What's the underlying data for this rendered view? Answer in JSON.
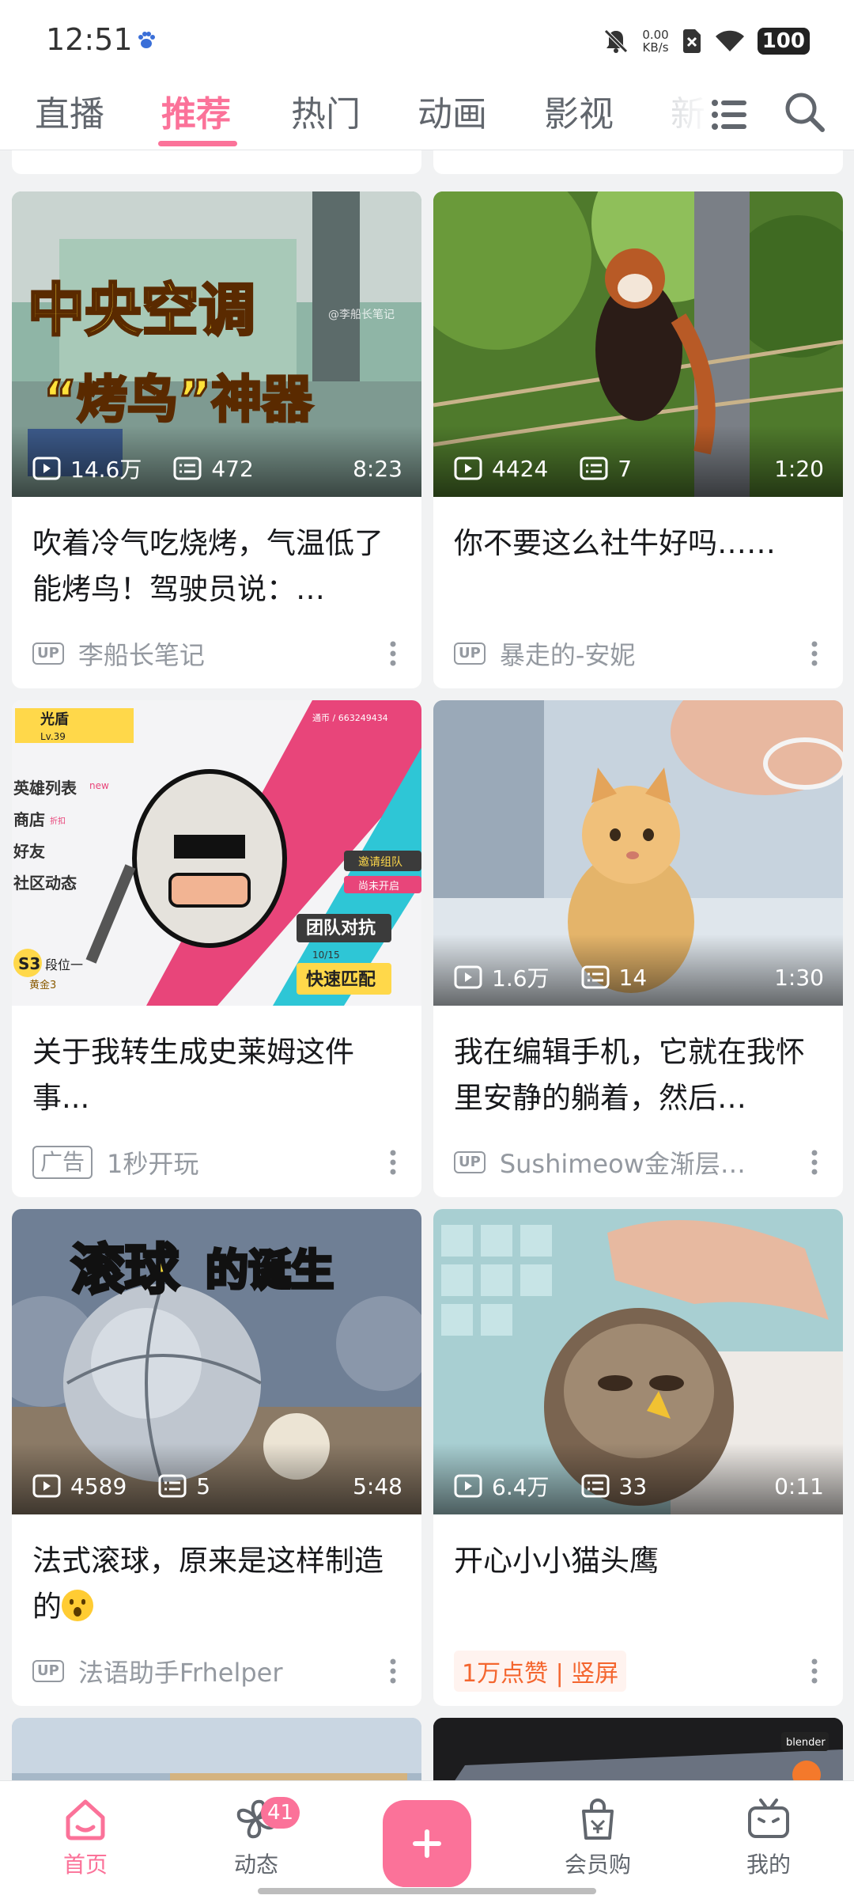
{
  "status_bar": {
    "time": "12:51",
    "net_speed_value": "0.00",
    "net_speed_unit": "KB/s",
    "battery": "100",
    "icons": [
      "baidu-paw-icon",
      "mute-icon",
      "sim-x-icon",
      "wifi-icon",
      "battery-icon"
    ]
  },
  "tabs": {
    "items": [
      {
        "label": "直播",
        "active": false
      },
      {
        "label": "推荐",
        "active": true
      },
      {
        "label": "热门",
        "active": false
      },
      {
        "label": "动画",
        "active": false
      },
      {
        "label": "影视",
        "active": false
      },
      {
        "label": "新",
        "active": false
      }
    ],
    "accent_color": "#fb7299"
  },
  "feed": {
    "cards": [
      {
        "plays": "14.6万",
        "danmaku": "472",
        "duration": "8:23",
        "cover_text_line1": "中央空调",
        "cover_text_line2": "“烤鸟”神器",
        "cover_watermark": "@李船长笔记",
        "title": "吹着冷气吃烧烤，气温低了能烤鸟！驾驶员说：…",
        "tag": "UP",
        "uploader": "李船长笔记"
      },
      {
        "plays": "4424",
        "danmaku": "7",
        "duration": "1:20",
        "title": "你不要这么社牛好吗……",
        "tag": "UP",
        "uploader": "暴走的-安妮"
      },
      {
        "cover_lines": {
          "name": "光盾",
          "level": "Lv.39",
          "id": "通币 / 663249434",
          "menu": [
            "英雄列表",
            "商店",
            "好友",
            "社区动态"
          ],
          "new_badge": "new",
          "shop_badge": "折扣",
          "invite": "邀请组队",
          "not_open": "尚未开启",
          "team_battle": "团队对抗",
          "quick_match": "快速匹配",
          "season": "S3",
          "rank": "段位一",
          "gold": "黄金3",
          "date": "10/15"
        },
        "title": "关于我转生成史莱姆这件事...",
        "tag": "广告",
        "uploader": "1秒开玩"
      },
      {
        "plays": "1.6万",
        "danmaku": "14",
        "duration": "1:30",
        "title": "我在编辑手机，它就在我怀里安静的躺着，然后…",
        "tag": "UP",
        "uploader": "Sushimeow金渐层…"
      },
      {
        "plays": "4589",
        "danmaku": "5",
        "duration": "5:48",
        "cover_text_part1": "滚球",
        "cover_text_part2": "的诞生",
        "title": "法式滚球，原来是这样制造的",
        "title_emoji": "surprised-face-emoji",
        "tag": "UP",
        "uploader": "法语助手Frhelper"
      },
      {
        "plays": "6.4万",
        "danmaku": "33",
        "duration": "0:11",
        "title": "开心小小猫头鹰",
        "hot_tag": "1万点赞 | 竖屏"
      }
    ],
    "peek_badge": "blender"
  },
  "bottom_nav": {
    "items": [
      {
        "label": "首页",
        "icon": "home-icon",
        "active": true
      },
      {
        "label": "动态",
        "icon": "pinwheel-icon",
        "badge": "41"
      },
      {
        "label": "",
        "icon": "plus-icon"
      },
      {
        "label": "会员购",
        "icon": "shopping-bag-icon"
      },
      {
        "label": "我的",
        "icon": "tv-icon"
      }
    ]
  }
}
